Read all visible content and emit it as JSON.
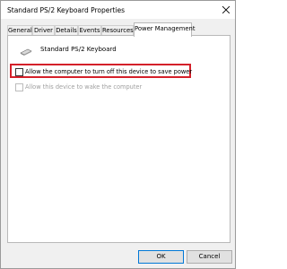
{
  "window": {
    "title": "Standard PS/2 Keyboard Properties",
    "close_icon": "close-icon"
  },
  "tabs": [
    {
      "label": "General",
      "active": false
    },
    {
      "label": "Driver",
      "active": false
    },
    {
      "label": "Details",
      "active": false
    },
    {
      "label": "Events",
      "active": false
    },
    {
      "label": "Resources",
      "active": false
    },
    {
      "label": "Power Management",
      "active": true
    }
  ],
  "panel": {
    "device_icon": "keyboard-icon",
    "device_name": "Standard PS/2 Keyboard",
    "options": [
      {
        "label": "Allow the computer to turn off this device to save power",
        "checked": false,
        "enabled": true,
        "highlighted": true
      },
      {
        "label": "Allow this device to wake the computer",
        "checked": false,
        "enabled": false,
        "highlighted": false
      }
    ],
    "highlight_color": "#d4202a"
  },
  "buttons": {
    "ok_label": "OK",
    "cancel_label": "Cancel"
  }
}
